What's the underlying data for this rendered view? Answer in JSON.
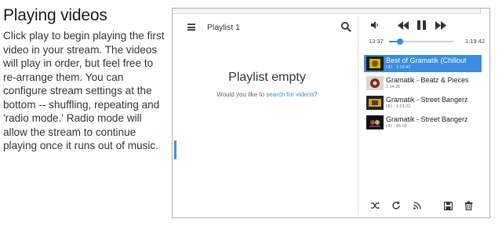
{
  "help": {
    "heading": "Playing videos",
    "body": "Click play to begin playing the first video in your stream. The videos will play in order, but feel free to re-arrange them. You can configure stream settings at the bottom -- shuffling, repeating and 'radio mode.' Radio mode will allow the stream to continue playing once it runs out of music."
  },
  "playlist": {
    "title": "Playlist 1",
    "empty_title": "Playlist empty",
    "empty_prompt": "Would you like to",
    "empty_link": "search for videos",
    "empty_suffix": "?"
  },
  "player": {
    "elapsed": "13:37",
    "duration": "1:19:42",
    "progress_fraction": 0.171
  },
  "queue": [
    {
      "title": "Best of Gramatik (Chillout ",
      "meta": "HD · 1:19:42",
      "active": true
    },
    {
      "title": "Gramatik - Beatz & Pieces ",
      "meta": "1:14:25",
      "active": false
    },
    {
      "title": "Gramatik - Street Bangerz ",
      "meta": "HD · 1:21:22",
      "active": false
    },
    {
      "title": "Gramatik - Street Bangerz ",
      "meta": "HD · 45:03",
      "active": false
    }
  ],
  "icons": {
    "menu": "menu-icon",
    "search": "search-icon",
    "volume": "volume-icon",
    "previous": "rewind-icon",
    "pause": "pause-icon",
    "next": "fast-forward-icon",
    "shuffle": "shuffle-icon",
    "repeat": "repeat-icon",
    "radio": "radio-icon",
    "save": "save-icon",
    "delete": "trash-icon"
  },
  "colors": {
    "accent": "#3a8de0",
    "active_row": "#3a8de0"
  }
}
